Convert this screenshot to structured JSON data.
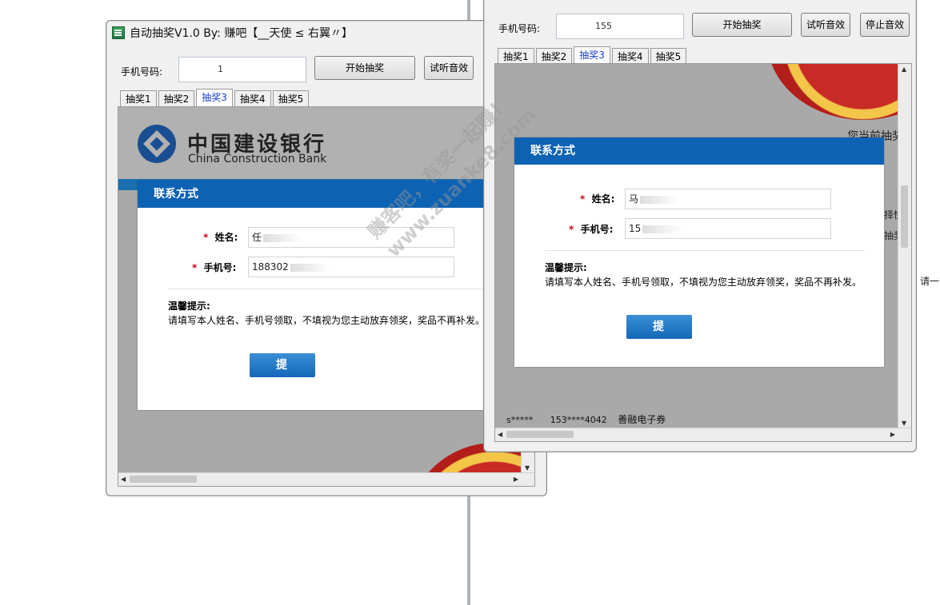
{
  "window1": {
    "title": "自动抽奖V1.0   By: 赚吧【__天使 ≤ 右翼〃】",
    "phone_label": "手机号码:",
    "phone_value": "1",
    "start_button": "开始抽奖",
    "test_sound_button": "试听音效",
    "tabs": [
      "抽奖1",
      "抽奖2",
      "抽奖3",
      "抽奖4",
      "抽奖5"
    ],
    "bank_name_cn": "中国建设银行",
    "bank_name_en": "China Construction Bank",
    "dialog": {
      "header": "联系方式",
      "name_label": "姓名:",
      "name_value": "任",
      "phone_label": "手机号:",
      "phone_value": "188302",
      "hint_title": "温馨提示:",
      "hint_body": "请填写本人姓名、手机号领取，不填视为您主动放弃领奖，奖品不再补发。",
      "submit": "提 交"
    }
  },
  "window2": {
    "phone_label": "手机号码:",
    "phone_value": "155",
    "start_button": "开始抽奖",
    "test_sound_button": "试听音效",
    "stop_sound_button": "停止音效",
    "tabs": [
      "抽奖1",
      "抽奖2",
      "抽奖3",
      "抽奖4",
      "抽奖5"
    ],
    "dialog": {
      "header": "联系方式",
      "name_label": "姓名:",
      "name_value": "马",
      "phone_label": "手机号:",
      "phone_value": "15",
      "hint_title": "温馨提示:",
      "hint_body": "请填写本人姓名、手机号领取，不填视为您主动放弃领奖，奖品不再补发。",
      "submit": "提 交"
    },
    "bg_partial_1": "您当前抽奖",
    "bg_partial_2": "择快",
    "bg_partial_3": "抽奖",
    "winner_row": {
      "user": "s*****",
      "phone": "153****4042",
      "prize": "善融电子券"
    }
  },
  "outside_partial": "请一?",
  "watermark": {
    "line1": "赚客吧，有奖一起赚！",
    "line2": "www.zuanke8.com"
  }
}
